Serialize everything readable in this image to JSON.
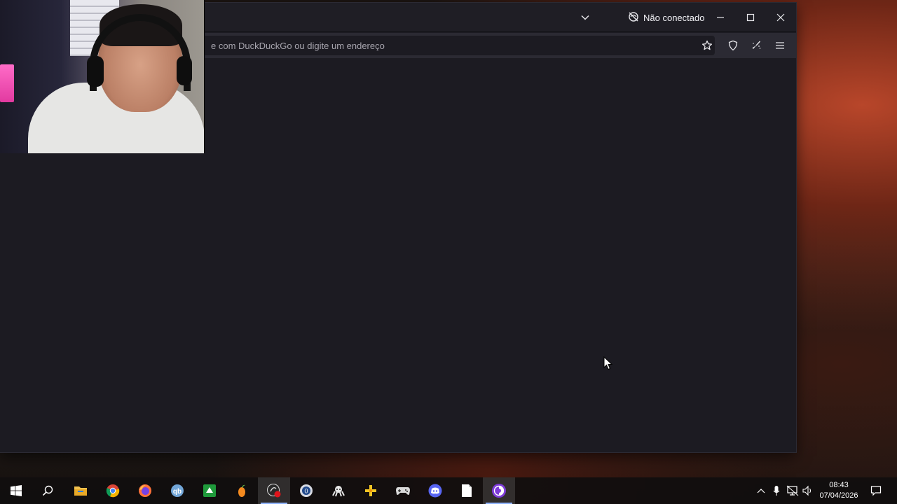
{
  "browser": {
    "status_text": "Não conectado",
    "url_placeholder": "e com DuckDuckGo ou digite um endereço",
    "icons": {
      "list_all_tabs": "chevron-down-icon",
      "not_connected": "no-connection-icon",
      "minimize": "minimize-icon",
      "maximize": "maximize-icon",
      "close": "close-icon",
      "bookmark": "star-icon",
      "shield": "shield-icon",
      "clean": "broom-icon",
      "menu": "hamburger-menu-icon"
    }
  },
  "taskbar": {
    "apps": [
      {
        "name": "start",
        "icon": "windows-logo-icon"
      },
      {
        "name": "search",
        "icon": "search-icon"
      },
      {
        "name": "file-explorer",
        "icon": "folder-icon"
      },
      {
        "name": "chrome",
        "icon": "chrome-icon"
      },
      {
        "name": "firefox",
        "icon": "firefox-icon"
      },
      {
        "name": "qbittorrent",
        "icon": "qbittorrent-icon"
      },
      {
        "name": "camtasia",
        "icon": "camtasia-icon"
      },
      {
        "name": "fl-studio",
        "icon": "fl-studio-icon"
      },
      {
        "name": "obs",
        "icon": "obs-recording-icon"
      },
      {
        "name": "steam-like",
        "icon": "circle-app-icon"
      },
      {
        "name": "octopus-app",
        "icon": "octopus-icon"
      },
      {
        "name": "puzzle-app",
        "icon": "puzzle-icon"
      },
      {
        "name": "game-controller",
        "icon": "gamepad-icon"
      },
      {
        "name": "discord",
        "icon": "discord-icon"
      },
      {
        "name": "notepad",
        "icon": "document-icon"
      },
      {
        "name": "tor-browser",
        "icon": "tor-icon"
      }
    ],
    "tray": {
      "time": "08:43",
      "date": "07/04/2026"
    }
  },
  "colors": {
    "window_bg": "#1c1b22",
    "toolbar_bg": "#2b2a33",
    "taskbar_bg": "#100e0e",
    "active_indicator": "#8fb4ff"
  }
}
